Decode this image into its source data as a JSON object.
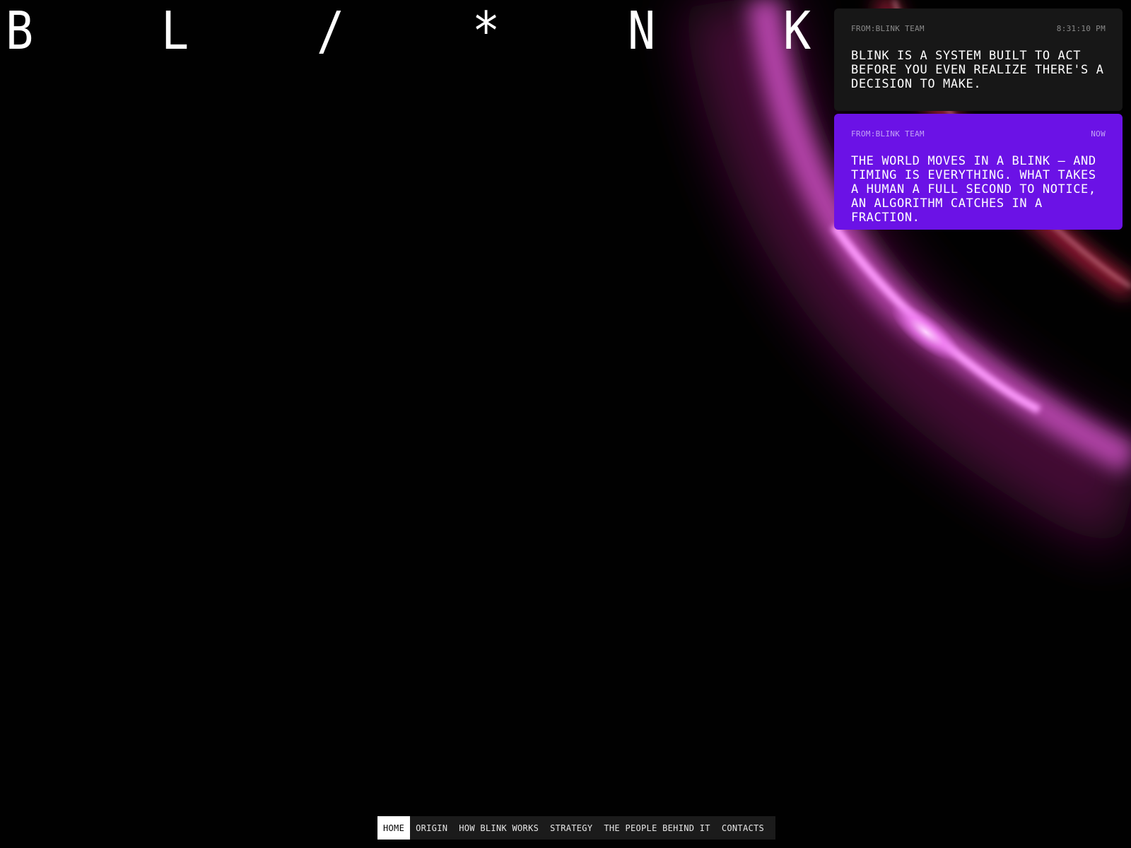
{
  "logo": {
    "letters": [
      "B",
      "L",
      "/",
      "*",
      "N",
      "K"
    ]
  },
  "messages": [
    {
      "from": "FROM:BLINK TEAM",
      "time": "8:31:10 PM",
      "text": "BLINK IS A SYSTEM BUILT TO ACT BEFORE YOU EVEN REALIZE THERE'S A DECISION TO MAKE.",
      "background": "#171717"
    },
    {
      "from": "FROM:BLINK TEAM",
      "time": "NOW",
      "text": "THE WORLD MOVES IN A BLINK — AND TIMING IS EVERYTHING. WHAT TAKES A HUMAN A FULL SECOND TO NOTICE, AN ALGORITHM CATCHES IN A FRACTION.",
      "background": "#6b12e6"
    }
  ],
  "nav": {
    "items": [
      {
        "label": "HOME",
        "active": true
      },
      {
        "label": "ORIGIN",
        "active": false
      },
      {
        "label": "HOW BLINK WORKS",
        "active": false
      },
      {
        "label": "STRATEGY",
        "active": false
      },
      {
        "label": "THE PEOPLE BEHIND IT",
        "active": false
      },
      {
        "label": "CONTACTS",
        "active": false
      }
    ]
  },
  "colors": {
    "background": "#010101",
    "accent": "#6b12e6",
    "glow_pink": "#e36ee8",
    "glow_red": "#d0264a"
  }
}
